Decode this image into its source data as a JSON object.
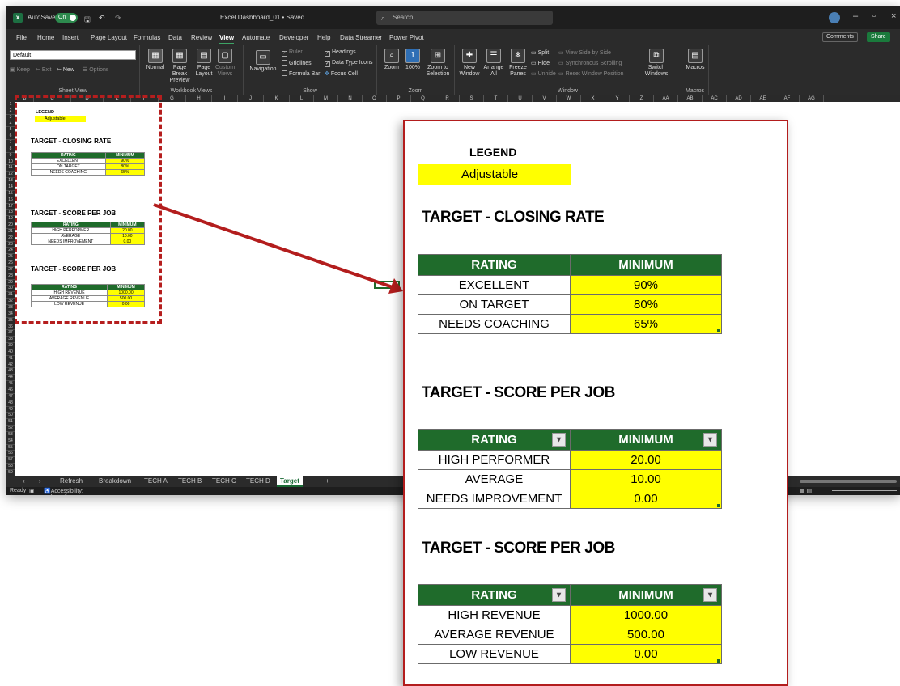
{
  "title_bar": {
    "autosave": "AutoSave",
    "toggle": "On",
    "filename": "Excel Dashboard_01 • Saved",
    "search_placeholder": "Search"
  },
  "menu": {
    "items": [
      "File",
      "Home",
      "Insert",
      "Page Layout",
      "Formulas",
      "Data",
      "Review",
      "View",
      "Automate",
      "Developer",
      "Help",
      "Data Streamer",
      "Power Pivot"
    ],
    "active": "View",
    "comments": "Comments",
    "share": "Share"
  },
  "ribbon": {
    "sheet_view": {
      "dropdown": "Default",
      "keep": "Keep",
      "exit": "Exit",
      "new": "New",
      "options": "Options",
      "label": "Sheet View"
    },
    "workbook_views": {
      "normal": "Normal",
      "page_break": "Page Break Preview",
      "page_layout": "Page Layout",
      "custom": "Custom Views",
      "label": "Workbook Views"
    },
    "show": {
      "navigation": "Navigation",
      "ruler": "Ruler",
      "gridlines": "Gridlines",
      "formula_bar": "Formula Bar",
      "headings": "Headings",
      "data_type_icons": "Data Type Icons",
      "focus_cell": "Focus Cell",
      "label": "Show"
    },
    "zoom": {
      "zoom": "Zoom",
      "hundred": "100%",
      "zoom_to_selection": "Zoom to Selection",
      "label": "Zoom"
    },
    "window": {
      "new_window": "New Window",
      "arrange_all": "Arrange All",
      "freeze_panes": "Freeze Panes",
      "split": "Split",
      "hide": "Hide",
      "unhide": "Unhide",
      "side_by_side": "View Side by Side",
      "sync_scroll": "Synchronous Scrolling",
      "reset_pos": "Reset Window Position",
      "switch": "Switch Windows",
      "label": "Window"
    },
    "macros": {
      "macros": "Macros",
      "label": "Macros"
    }
  },
  "columns": [
    "B",
    "C",
    "D",
    "E",
    "F",
    "G",
    "H",
    "I",
    "J",
    "K",
    "L",
    "M",
    "N",
    "O",
    "P",
    "Q",
    "R",
    "S",
    "T",
    "U",
    "V",
    "W",
    "X",
    "Y",
    "Z",
    "AA",
    "AB",
    "AC",
    "AD",
    "AE",
    "AF",
    "AG"
  ],
  "legend": {
    "title": "LEGEND",
    "adjustable": "Adjustable"
  },
  "tables": [
    {
      "title": "TARGET - CLOSING RATE",
      "header": [
        "RATING",
        "MINIMUM"
      ],
      "filters": false,
      "rows": [
        [
          "EXCELLENT",
          "90%"
        ],
        [
          "ON TARGET",
          "80%"
        ],
        [
          "NEEDS COACHING",
          "65%"
        ]
      ]
    },
    {
      "title": "TARGET - SCORE PER JOB",
      "header": [
        "RATING",
        "MINIMUM"
      ],
      "filters": true,
      "rows": [
        [
          "HIGH PERFORMER",
          "20.00"
        ],
        [
          "AVERAGE",
          "10.00"
        ],
        [
          "NEEDS IMPROVEMENT",
          "0.00"
        ]
      ]
    },
    {
      "title": "TARGET - SCORE PER JOB",
      "header": [
        "RATING",
        "MINIMUM"
      ],
      "filters": true,
      "rows": [
        [
          "HIGH REVENUE",
          "1000.00"
        ],
        [
          "AVERAGE REVENUE",
          "500.00"
        ],
        [
          "LOW REVENUE",
          "0.00"
        ]
      ]
    }
  ],
  "sheet_tabs": {
    "items": [
      "Refresh",
      "Breakdown",
      "TECH A",
      "TECH B",
      "TECH C",
      "TECH D",
      "Target"
    ],
    "active": "Target",
    "add": "+"
  },
  "status": {
    "ready": "Ready",
    "accessibility": "Accessibility: Investigate"
  },
  "colors": {
    "header_green": "#1f6b2b",
    "adjustable_yellow": "#ffff00",
    "callout_red": "#b31d1d"
  }
}
